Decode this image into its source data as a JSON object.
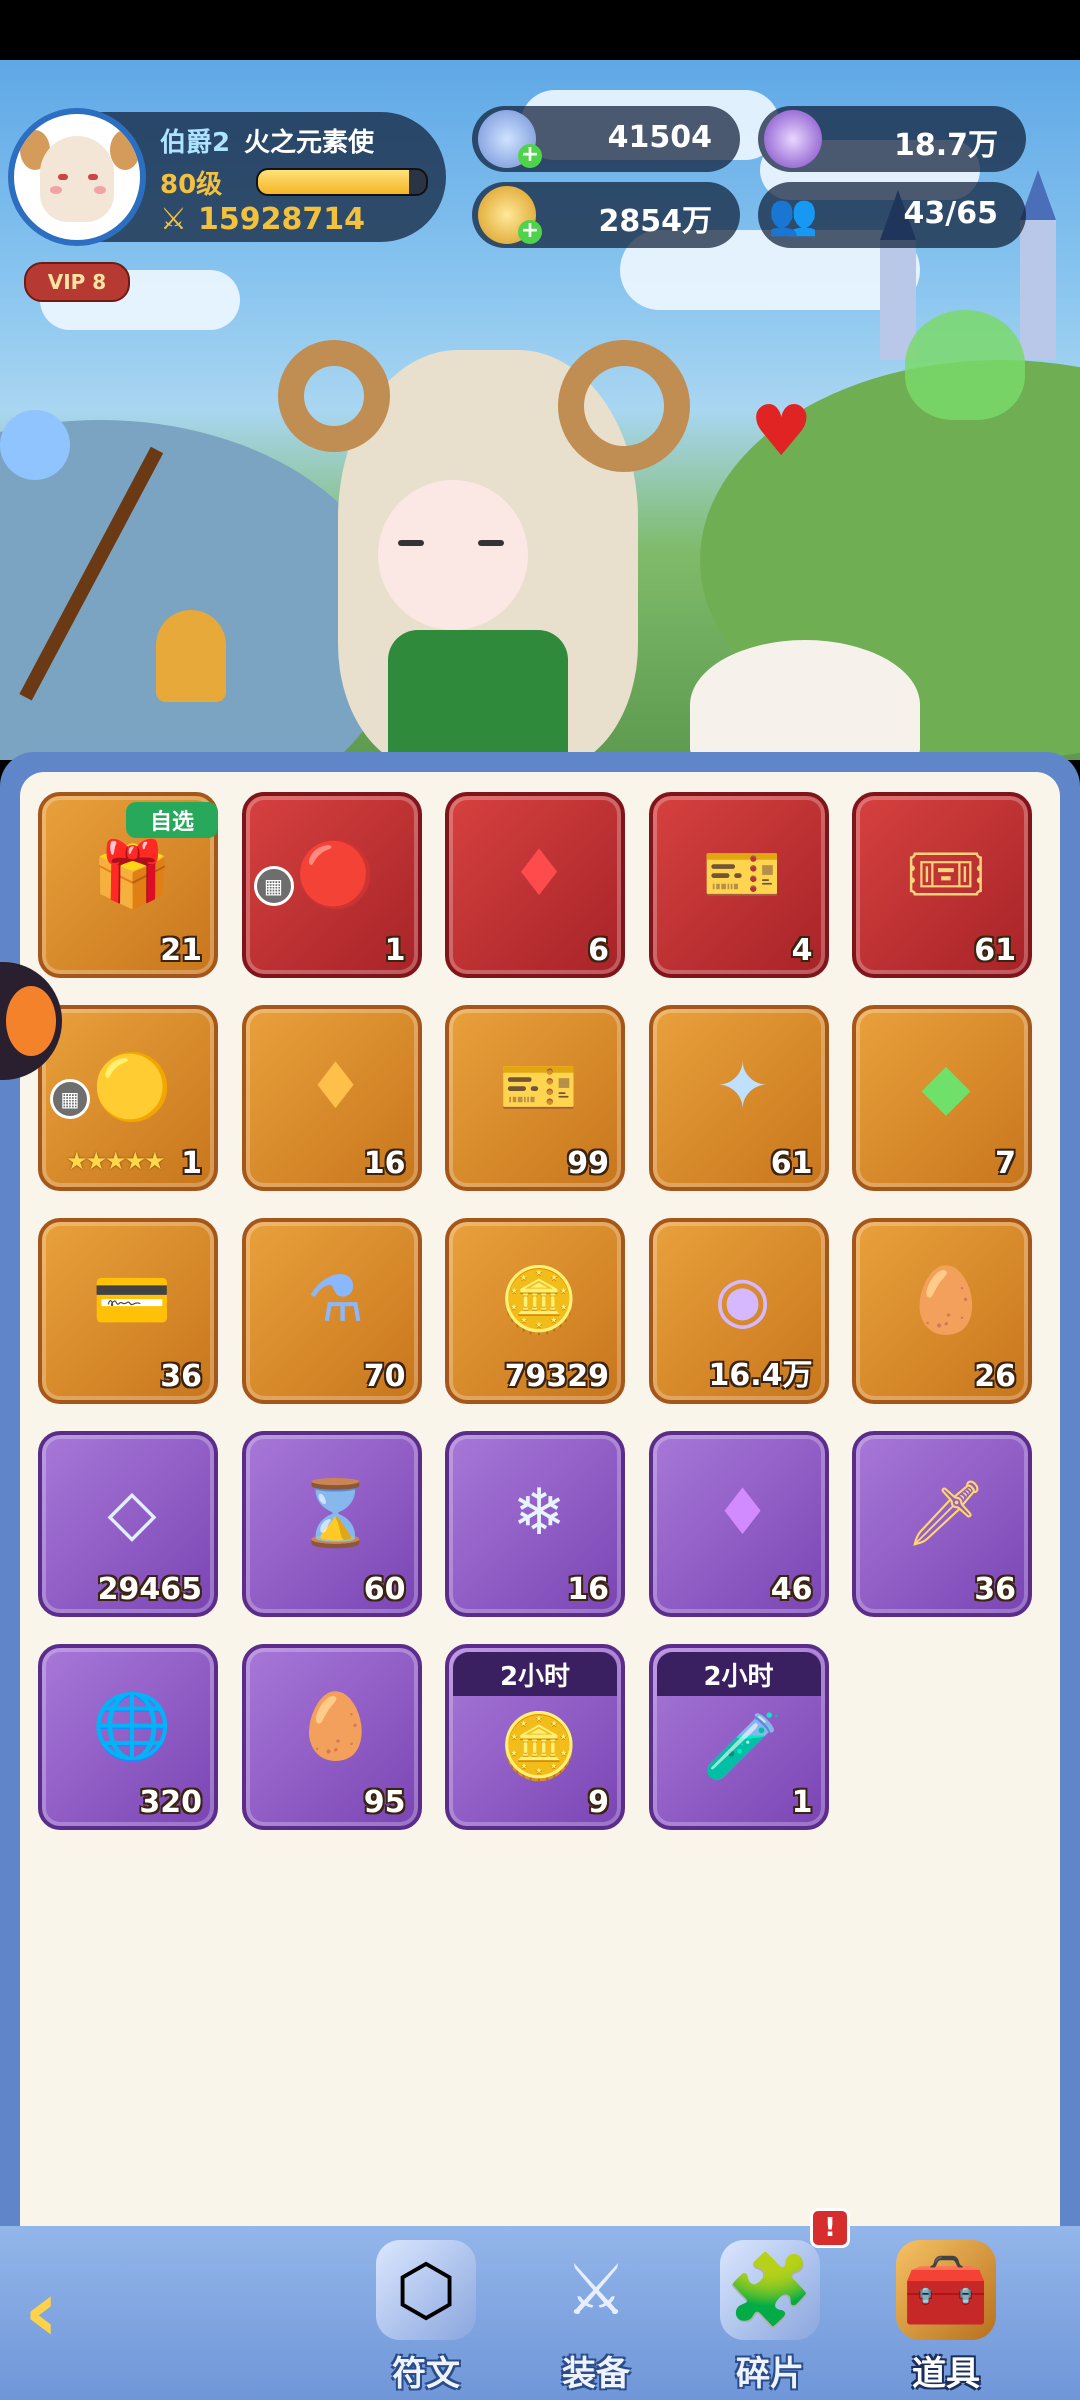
{
  "profile": {
    "rank": "伯爵2",
    "title": "火之元素使",
    "level": "80级",
    "xp_fraction": 0.9,
    "power": "15928714",
    "vip": "VIP 8"
  },
  "currencies": {
    "star": "41504",
    "purple_orb": "18.7万",
    "gold": "2854万",
    "friends": "43/65"
  },
  "items": [
    {
      "rarity": "gold",
      "icon": "gift-box-icon",
      "glyph": "🎁",
      "count": "21",
      "badge": "自选"
    },
    {
      "rarity": "red",
      "icon": "red-orb-icon",
      "glyph": "🔴",
      "count": "1",
      "grid": true
    },
    {
      "rarity": "red",
      "icon": "red-crystal-icon",
      "glyph": "♦",
      "count": "6"
    },
    {
      "rarity": "red",
      "icon": "blue-ticket-icon",
      "glyph": "🎫",
      "count": "4"
    },
    {
      "rarity": "red",
      "icon": "gold-ticket-icon",
      "glyph": "🎟",
      "count": "61"
    },
    {
      "rarity": "gold",
      "icon": "gold-orb-icon",
      "glyph": "🟡",
      "count": "1",
      "grid": true,
      "stars": "★★★★★"
    },
    {
      "rarity": "gold",
      "icon": "amber-crystal-icon",
      "glyph": "♦",
      "count": "16"
    },
    {
      "rarity": "gold",
      "icon": "orange-ticket-icon",
      "glyph": "🎫",
      "count": "99"
    },
    {
      "rarity": "gold",
      "icon": "blue-star-icon",
      "glyph": "✦",
      "count": "61"
    },
    {
      "rarity": "gold",
      "icon": "green-gem-icon",
      "glyph": "◆",
      "count": "7"
    },
    {
      "rarity": "gold",
      "icon": "heart-card-icon",
      "glyph": "💳",
      "count": "36"
    },
    {
      "rarity": "gold",
      "icon": "potion-icon",
      "glyph": "⚗",
      "count": "70"
    },
    {
      "rarity": "gold",
      "icon": "gold-coin-icon",
      "glyph": "🪙",
      "count": "79329"
    },
    {
      "rarity": "gold",
      "icon": "purple-coin-icon",
      "glyph": "◉",
      "count": "16.4万"
    },
    {
      "rarity": "gold",
      "icon": "dragon-egg-icon",
      "glyph": "🥚",
      "count": "26"
    },
    {
      "rarity": "purple",
      "icon": "diamond-shard-icon",
      "glyph": "◇",
      "count": "29465"
    },
    {
      "rarity": "purple",
      "icon": "hourglass-icon",
      "glyph": "⌛",
      "count": "60"
    },
    {
      "rarity": "purple",
      "icon": "ice-crystal-icon",
      "glyph": "❄",
      "count": "16"
    },
    {
      "rarity": "purple",
      "icon": "purple-crystal-icon",
      "glyph": "♦",
      "count": "46"
    },
    {
      "rarity": "purple",
      "icon": "sword-card-icon",
      "glyph": "🗡",
      "count": "36"
    },
    {
      "rarity": "purple",
      "icon": "planet-orb-icon",
      "glyph": "🌐",
      "count": "320"
    },
    {
      "rarity": "purple",
      "icon": "purple-egg-icon",
      "glyph": "🥚",
      "count": "95"
    },
    {
      "rarity": "purple",
      "icon": "coin-pile-icon",
      "glyph": "🪙",
      "count": "9",
      "time": "2小时"
    },
    {
      "rarity": "purple",
      "icon": "green-potion-icon",
      "glyph": "🧪",
      "count": "1",
      "time": "2小时"
    }
  ],
  "nav": {
    "rune": "符文",
    "equip": "装备",
    "fragment": "碎片",
    "items": "道具",
    "alert": "!"
  }
}
